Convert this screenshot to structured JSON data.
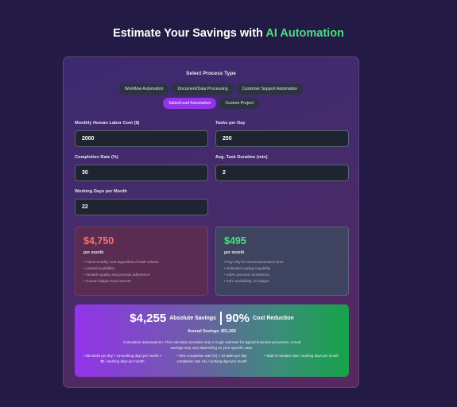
{
  "header": {
    "title_prefix": "Estimate Your Savings with ",
    "title_accent": "AI Automation",
    "accent_color": "#4ade80"
  },
  "process": {
    "label": "Select Process Type",
    "options": [
      {
        "label": "Workflow Automation",
        "active": false
      },
      {
        "label": "Document/Data Processing",
        "active": false
      },
      {
        "label": "Customer Support Automation",
        "active": false
      },
      {
        "label": "Sales/Lead Automation",
        "active": true
      },
      {
        "label": "Custom Project",
        "active": false
      }
    ]
  },
  "fields": {
    "labor_cost": {
      "label": "Monthly Human Labor Cost ($)",
      "value": "2000"
    },
    "tasks_per_day": {
      "label": "Tasks per Day",
      "value": "250"
    },
    "completion_rate": {
      "label": "Completion Rate (%)",
      "value": "30"
    },
    "task_duration": {
      "label": "Avg. Task Duration (min)",
      "value": "2"
    },
    "working_days": {
      "label": "Working Days per Month",
      "value": "22"
    }
  },
  "human_cost": {
    "amount": "$4,750",
    "period": "per month",
    "color": "#f87171",
    "bullets": [
      "Fixed monthly cost regardless of task volume",
      "Limited scalability",
      "Variable quality and process adherence",
      "Human fatigue and turnover"
    ]
  },
  "ai_cost": {
    "amount": "$495",
    "period": "per month",
    "color": "#4ade80",
    "bullets": [
      "Pay only for actual automated work",
      "Unlimited scaling capability",
      "100% process consistency",
      "24/7 availability, no fatigue"
    ]
  },
  "savings": {
    "absolute": "$4,255",
    "absolute_label": "Absolute Savings",
    "percent": "90%",
    "percent_label": "Cost Reduction",
    "annual": "Annual Savings: $51,060",
    "note": "Calculation assumptions: This calculator provides only a rough estimate for typical business processes. Actual savings may vary depending on your specific case.",
    "assumptions": [
      "• 250 tasks per day × 22 working days per month × $0 / working days per month",
      "• 30% completion rate (%) × 10 tasks per day completion rate (%) / working days per month",
      "• Total AI minutes: 500 / working days per month"
    ]
  }
}
